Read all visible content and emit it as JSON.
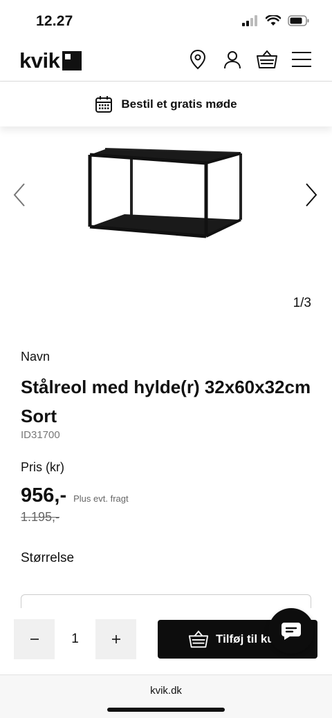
{
  "status_bar": {
    "time": "12.27",
    "icons": [
      "signal-icon",
      "wifi-icon",
      "battery-icon"
    ]
  },
  "header": {
    "logo_text": "kvik",
    "icons": [
      "location-pin-icon",
      "user-icon",
      "basket-icon",
      "menu-icon"
    ]
  },
  "meeting_bar": {
    "icon": "calendar-icon",
    "label": "Bestil et gratis møde"
  },
  "carousel": {
    "counter": "1/3",
    "prev_icon": "chevron-left-icon",
    "next_icon": "chevron-right-icon"
  },
  "product": {
    "name_label": "Navn",
    "title": "Stålreol med hylde(r) 32x60x32cm Sort",
    "id": "ID31700",
    "price_label": "Pris (kr)",
    "price": "956,-",
    "price_note": "Plus evt. fragt",
    "old_price": "1.195,-",
    "size_label": "Størrelse"
  },
  "actions": {
    "quantity": "1",
    "add_label": "Tilføj til kurv",
    "minus_icon": "minus-icon",
    "plus_icon": "plus-icon",
    "chat_icon": "chat-icon"
  },
  "browser": {
    "url": "kvik.dk"
  },
  "colors": {
    "primary": "#0d0d0d",
    "muted": "#777777",
    "qty_bg": "#f0f0f0"
  }
}
